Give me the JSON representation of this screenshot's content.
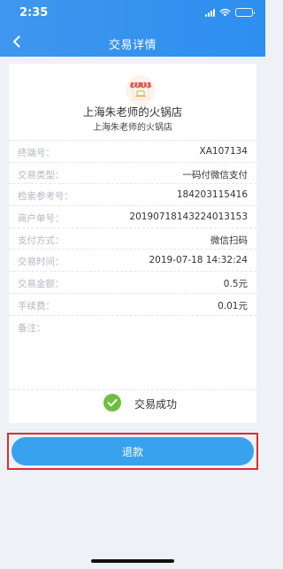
{
  "status_bar": {
    "time": "2:35"
  },
  "nav": {
    "title": "交易详情"
  },
  "store": {
    "name": "上海朱老师的火锅店",
    "subname": "上海朱老师的火锅店"
  },
  "details": [
    {
      "label": "终端号：",
      "value": "XA107134"
    },
    {
      "label": "交易类型：",
      "value": "一码付微信支付"
    },
    {
      "label": "检索参考号：",
      "value": "184203115416"
    },
    {
      "label": "商户单号：",
      "value": "20190718143224013153"
    },
    {
      "label": "支付方式：",
      "value": "微信扫码"
    },
    {
      "label": "交易时间：",
      "value": "2019-07-18 14:32:24"
    },
    {
      "label": "交易金额：",
      "value": "0.5元"
    },
    {
      "label": "手续费：",
      "value": "0.01元"
    },
    {
      "label": "备注：",
      "value": ""
    }
  ],
  "result": {
    "text": "交易成功"
  },
  "actions": {
    "refund_label": "退款"
  },
  "colors": {
    "header": "#3a93ee",
    "button": "#38a2ee",
    "success": "#6cbf42",
    "highlight": "#d83030"
  }
}
